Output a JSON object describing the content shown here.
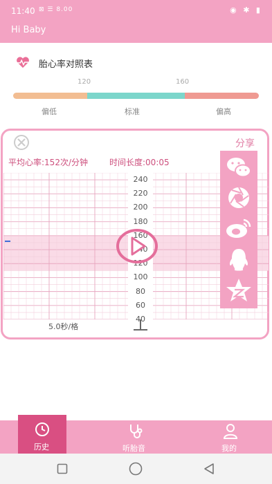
{
  "status": {
    "time": "11:40",
    "icons": "⊠ ☰ 8.00",
    "right": "◉ ✱ ▮"
  },
  "app": {
    "title": "Hi Baby"
  },
  "reference": {
    "title": "胎心率对照表",
    "ticks": [
      "120",
      "160"
    ],
    "segments": [
      {
        "label": "偏低",
        "color": "#f2bd92"
      },
      {
        "label": "标准",
        "color": "#7cd6cb"
      },
      {
        "label": "偏高",
        "color": "#ef9a92"
      }
    ]
  },
  "card": {
    "share": "分享",
    "avg_heart_rate": "平均心率:152次/分钟",
    "duration": "时间长度:00:05",
    "y_labels": [
      "240",
      "220",
      "200",
      "180",
      "160",
      "140",
      "120",
      "100",
      "80",
      "60",
      "40"
    ],
    "scale": "5.0秒/格",
    "normal_band": [
      110,
      160
    ]
  },
  "share_targets": [
    "wechat-icon",
    "moments-icon",
    "weibo-icon",
    "qq-icon",
    "qzone-icon"
  ],
  "nav": {
    "history": "历史",
    "listen": "听胎音",
    "mine": "我的"
  },
  "colors": {
    "brand": "#f3a3c3",
    "active_tab": "#d94f82",
    "text_accent": "#cd4f7d"
  }
}
